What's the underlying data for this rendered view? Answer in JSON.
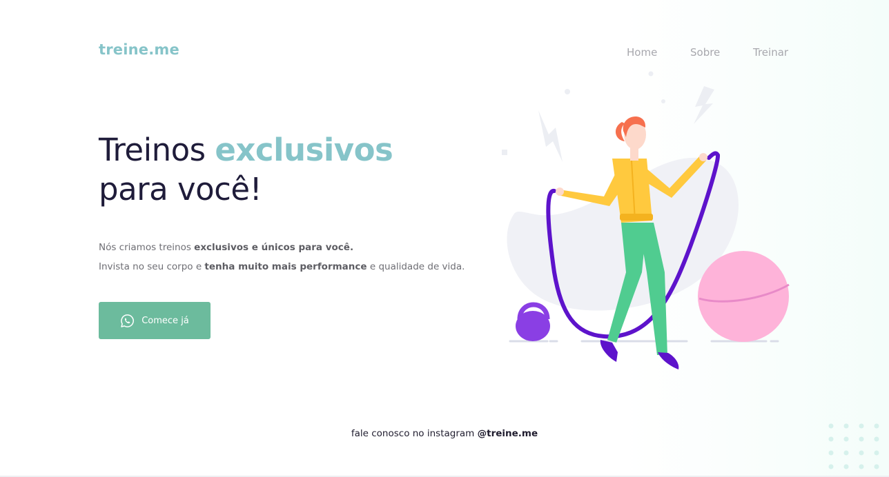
{
  "header": {
    "logo": "treine.me",
    "nav": [
      "Home",
      "Sobre",
      "Treinar"
    ]
  },
  "hero": {
    "title_part1": "Treinos ",
    "title_accent": "exclusivos",
    "title_line2": "para você!",
    "desc_line1_a": "Nós criamos treinos ",
    "desc_line1_b": "exclusivos e únicos para você.",
    "desc_line2_a": "Invista no seu corpo e ",
    "desc_line2_b": "tenha muito mais performance",
    "desc_line2_c": " e qualidade de vida.",
    "cta_label": "Comece já",
    "cta_icon": "whatsapp-icon"
  },
  "footer": {
    "text": "fale conosco no instagram ",
    "handle": "@treine.me"
  },
  "colors": {
    "accent": "#86c4c9",
    "cta": "#6cbb9d",
    "title": "#1f1c3a",
    "text": "#6e6e74"
  }
}
